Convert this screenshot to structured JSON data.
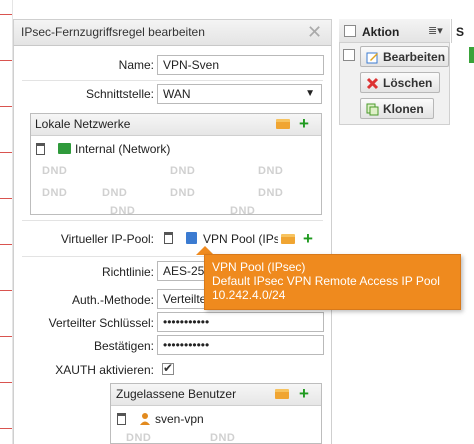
{
  "dialog": {
    "title": "IPsec-Fernzugriffsregel bearbeiten",
    "close_icon": "close-icon"
  },
  "form": {
    "name_label": "Name:",
    "name_value": "VPN-Sven",
    "interface_label": "Schnittstelle:",
    "interface_value": "WAN",
    "local_networks_title": "Lokale Netzwerke",
    "local_network_item": "Internal (Network)",
    "dnd": "DND",
    "virtual_ip_label": "Virtueller IP-Pool:",
    "virtual_ip_value": "VPN Pool (IPs",
    "policy_label": "Richtlinie:",
    "policy_value": "AES-25",
    "auth_label": "Auth.-Methode:",
    "auth_value": "Verteilter",
    "psk_label": "Verteilter Schlüssel:",
    "psk_value": "•••••••••••",
    "confirm_label": "Bestätigen:",
    "confirm_value": "•••••••••••",
    "xauth_label": "XAUTH aktivieren:",
    "allowed_users_title": "Zugelassene Benutzer",
    "allowed_user_item": "sven-vpn"
  },
  "tooltip": {
    "line1": "VPN Pool (IPsec)",
    "line2": "Default IPsec VPN Remote Access IP Pool",
    "line3": "10.242.4.0/24"
  },
  "actions": {
    "header": "Aktion",
    "edit": "Bearbeiten",
    "delete": "Löschen",
    "clone": "Klonen",
    "extra_header": "S"
  }
}
